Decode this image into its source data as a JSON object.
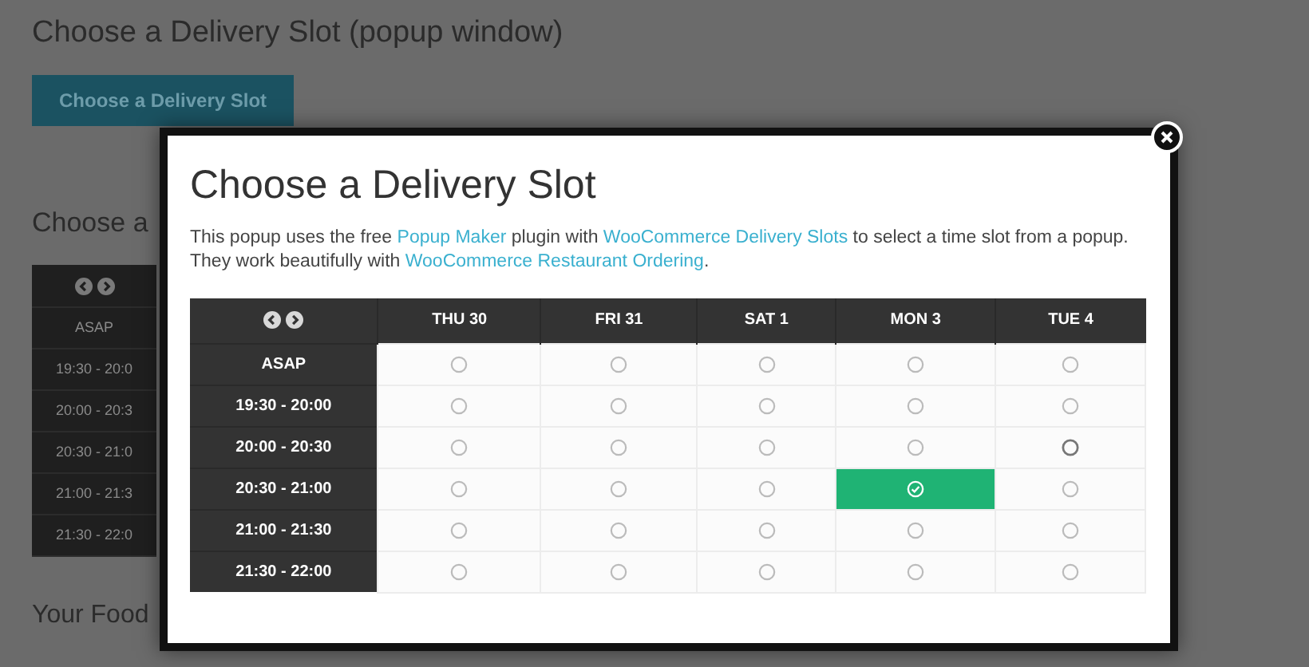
{
  "background": {
    "heading": "Choose a Delivery Slot (popup window)",
    "button": "Choose a Delivery Slot",
    "section_heading": "Choose a",
    "slot_table": {
      "rows": [
        "ASAP",
        "19:30 - 20:0",
        "20:00 - 20:3",
        "20:30 - 21:0",
        "21:00 - 21:3",
        "21:30 - 22:0"
      ]
    },
    "footer_heading": "Your Food"
  },
  "popup": {
    "title": "Choose a Delivery Slot",
    "intro": [
      {
        "kind": "text",
        "text": "This popup uses the free "
      },
      {
        "kind": "link",
        "text": "Popup Maker"
      },
      {
        "kind": "text",
        "text": " plugin with "
      },
      {
        "kind": "link",
        "text": "WooCommerce Delivery Slots"
      },
      {
        "kind": "text",
        "text": " to select a time slot from a popup. They work beautifully with "
      },
      {
        "kind": "link",
        "text": "WooCommerce Restaurant Ordering"
      },
      {
        "kind": "text",
        "text": "."
      }
    ],
    "table": {
      "columns": [
        "THU 30",
        "FRI 31",
        "SAT 1",
        "MON 3",
        "TUE 4"
      ],
      "rows": [
        {
          "label": "ASAP",
          "cells": [
            {
              "selected": false,
              "hovered": false
            },
            {
              "selected": false,
              "hovered": false
            },
            {
              "selected": false,
              "hovered": false
            },
            {
              "selected": false,
              "hovered": false
            },
            {
              "selected": false,
              "hovered": false
            }
          ]
        },
        {
          "label": "19:30 - 20:00",
          "cells": [
            {
              "selected": false,
              "hovered": false
            },
            {
              "selected": false,
              "hovered": false
            },
            {
              "selected": false,
              "hovered": false
            },
            {
              "selected": false,
              "hovered": false
            },
            {
              "selected": false,
              "hovered": false
            }
          ]
        },
        {
          "label": "20:00 - 20:30",
          "cells": [
            {
              "selected": false,
              "hovered": false
            },
            {
              "selected": false,
              "hovered": false
            },
            {
              "selected": false,
              "hovered": false
            },
            {
              "selected": false,
              "hovered": false
            },
            {
              "selected": false,
              "hovered": true
            }
          ]
        },
        {
          "label": "20:30 - 21:00",
          "cells": [
            {
              "selected": false,
              "hovered": false
            },
            {
              "selected": false,
              "hovered": false
            },
            {
              "selected": false,
              "hovered": false
            },
            {
              "selected": true,
              "hovered": false
            },
            {
              "selected": false,
              "hovered": false
            }
          ]
        },
        {
          "label": "21:00 - 21:30",
          "cells": [
            {
              "selected": false,
              "hovered": false
            },
            {
              "selected": false,
              "hovered": false
            },
            {
              "selected": false,
              "hovered": false
            },
            {
              "selected": false,
              "hovered": false
            },
            {
              "selected": false,
              "hovered": false
            }
          ]
        },
        {
          "label": "21:30 - 22:00",
          "cells": [
            {
              "selected": false,
              "hovered": false
            },
            {
              "selected": false,
              "hovered": false
            },
            {
              "selected": false,
              "hovered": false
            },
            {
              "selected": false,
              "hovered": false
            },
            {
              "selected": false,
              "hovered": false
            }
          ]
        }
      ]
    }
  }
}
